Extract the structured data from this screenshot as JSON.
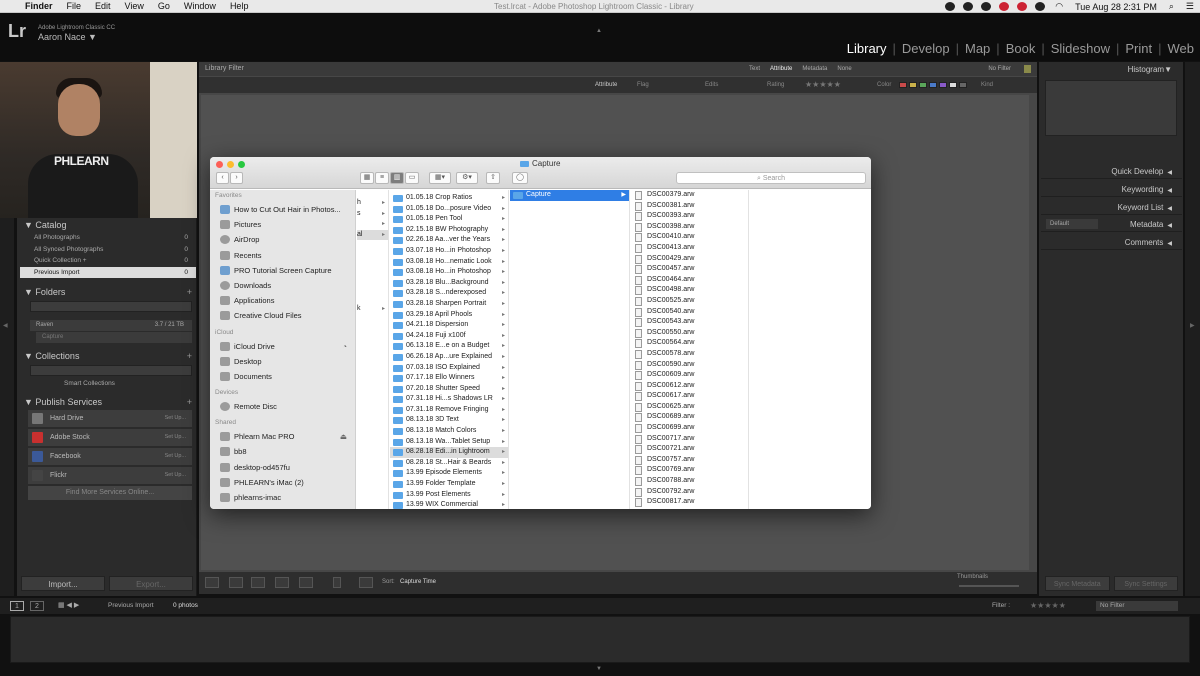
{
  "menubar": {
    "items": [
      "Finder",
      "File",
      "Edit",
      "View",
      "Go",
      "Window",
      "Help"
    ],
    "doc_title": "Test.lrcat - Adobe Photoshop Lightroom Classic - Library",
    "clock": "Tue Aug 28  2:31 PM"
  },
  "lr": {
    "logo": "Lr",
    "product": "Adobe Lightroom Classic CC",
    "user": "Aaron Nace ▼",
    "modules": [
      "Library",
      "Develop",
      "Map",
      "Book",
      "Slideshow",
      "Print",
      "Web"
    ],
    "active_module": "Library"
  },
  "video": {
    "shirt_text": "PHLEARN"
  },
  "catalog": {
    "title": "Catalog",
    "rows": [
      {
        "label": "All Photographs",
        "count": "0"
      },
      {
        "label": "All Synced Photographs",
        "count": "0"
      },
      {
        "label": "Quick Collection +",
        "count": "0"
      },
      {
        "label": "Previous Import",
        "count": "0"
      }
    ]
  },
  "folders": {
    "title": "Folders",
    "volume": "Raven",
    "volume_info": "3.7 / 21 TB",
    "sub": "Capture"
  },
  "collections": {
    "title": "Collections",
    "smart": "Smart Collections"
  },
  "publish": {
    "title": "Publish Services",
    "services": [
      {
        "label": "Hard Drive",
        "action": "Set Up...",
        "color": "#777777"
      },
      {
        "label": "Adobe Stock",
        "action": "Set Up...",
        "color": "#c8302f"
      },
      {
        "label": "Facebook",
        "action": "Set Up...",
        "color": "#3b5998"
      },
      {
        "label": "Flickr",
        "action": "Set Up...",
        "color": "#444444"
      }
    ],
    "find_more": "Find More Services Online..."
  },
  "left_buttons": {
    "import": "Import...",
    "export": "Export..."
  },
  "filter": {
    "title": "Library Filter",
    "options": [
      "Text",
      "Attribute",
      "Metadata",
      "None"
    ],
    "active_option": "Attribute",
    "no_filter": "No Filter",
    "attr_label": "Attribute",
    "flag": "Flag",
    "edits": "Edits",
    "rating": "Rating",
    "rating_stars": "★★★★★",
    "color": "Color",
    "kind": "Kind"
  },
  "right": {
    "histogram": "Histogram",
    "sections": [
      "Quick Develop",
      "Keywording",
      "Keyword List",
      "Metadata",
      "Comments"
    ],
    "metadata_preset": "Default",
    "sync_metadata": "Sync Metadata",
    "sync_settings": "Sync Settings"
  },
  "toolbar": {
    "sort_label": "Sort:",
    "sort_value": "Capture Time",
    "thumbnails": "Thumbnails"
  },
  "filmstrip": {
    "source": "Previous Import",
    "count": "0 photos",
    "filter_label": "Filter :",
    "no_filter": "No Filter",
    "page1": "1",
    "page2": "2"
  },
  "finder": {
    "title": "Capture",
    "search_placeholder": "Search",
    "favorites_label": "Favorites",
    "favorites": [
      "How to Cut Out Hair in Photos...",
      "Pictures",
      "AirDrop",
      "Recents",
      "PRO Tutorial Screen Capture",
      "Downloads",
      "Applications",
      "Creative Cloud Files"
    ],
    "icloud_label": "iCloud",
    "icloud": [
      "iCloud Drive",
      "Desktop",
      "Documents"
    ],
    "devices_label": "Devices",
    "devices": [
      "Remote Disc"
    ],
    "shared_label": "Shared",
    "shared": [
      "Phlearn Mac PRO",
      "bb8",
      "desktop-od457fu",
      "PHLEARN's iMac (2)",
      "phlearns-imac"
    ],
    "col1_fragments": [
      "h",
      "s",
      "al",
      "k"
    ],
    "folders": [
      "01.05.18 Crop Ratios",
      "01.05.18 Do...posure Video",
      "01.05.18 Pen Tool",
      "02.15.18 BW Photography",
      "02.26.18 Aa...ver the Years",
      "03.07.18 Ho...in Photoshop",
      "03.08.18 Ho...nematic Look",
      "03.08.18 Ho...in Photoshop",
      "03.28.18 Blu...Background",
      "03.28.18 S...nderexposed",
      "03.28.18 Sharpen Portrait",
      "03.29.18 April Phools",
      "04.21.18 Dispersion",
      "04.24.18 Fuji x100f",
      "06.13.18 E...e on a Budget",
      "06.26.18 Ap...ure Explained",
      "07.03.18 ISO Explained",
      "07.17.18 Ello Winners",
      "07.20.18 Shutter Speed",
      "07.31.18 Hi...s Shadows LR",
      "07.31.18 Remove Fringing",
      "08.13.18 3D Text",
      "08.13.18 Match Colors",
      "08.13.18 Wa...Tablet Setup",
      "08.28.18 Edi...in Lightroom",
      "08.28.18 St...Hair & Beards",
      "13.99 Episode Elements",
      "13.99 Folder Template",
      "13.99 Post Elements",
      "13.99 WIX Commercial"
    ],
    "selected_folder_index": 24,
    "subfolder": "Capture",
    "files": [
      "DSC00379.arw",
      "DSC00381.arw",
      "DSC00393.arw",
      "DSC00398.arw",
      "DSC00410.arw",
      "DSC00413.arw",
      "DSC00429.arw",
      "DSC00457.arw",
      "DSC00464.arw",
      "DSC00498.arw",
      "DSC00525.arw",
      "DSC00540.arw",
      "DSC00543.arw",
      "DSC00550.arw",
      "DSC00564.arw",
      "DSC00578.arw",
      "DSC00590.arw",
      "DSC00609.arw",
      "DSC00612.arw",
      "DSC00617.arw",
      "DSC00625.arw",
      "DSC00689.arw",
      "DSC00699.arw",
      "DSC00717.arw",
      "DSC00721.arw",
      "DSC00757.arw",
      "DSC00769.arw",
      "DSC00788.arw",
      "DSC00792.arw",
      "DSC00817.arw"
    ]
  }
}
